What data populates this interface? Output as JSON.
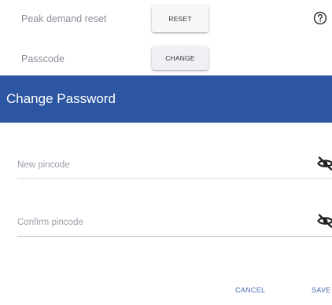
{
  "settings": {
    "peak_demand": {
      "label": "Peak demand reset",
      "button": "RESET"
    },
    "passcode": {
      "label": "Passcode",
      "button": "CHANGE"
    }
  },
  "help_icon": "question-circle-icon",
  "dialog": {
    "title": "Change Password",
    "new_pincode": {
      "placeholder": "New pincode",
      "value": "",
      "icon": "eye-off-icon"
    },
    "confirm_pincode": {
      "placeholder": "Confirm pincode",
      "value": "",
      "icon": "eye-off-icon"
    },
    "cancel_label": "CANCEL",
    "save_label": "SAVE"
  },
  "colors": {
    "header": "#2c56a2",
    "action": "#4a6ab6",
    "label": "#8a8f98"
  }
}
